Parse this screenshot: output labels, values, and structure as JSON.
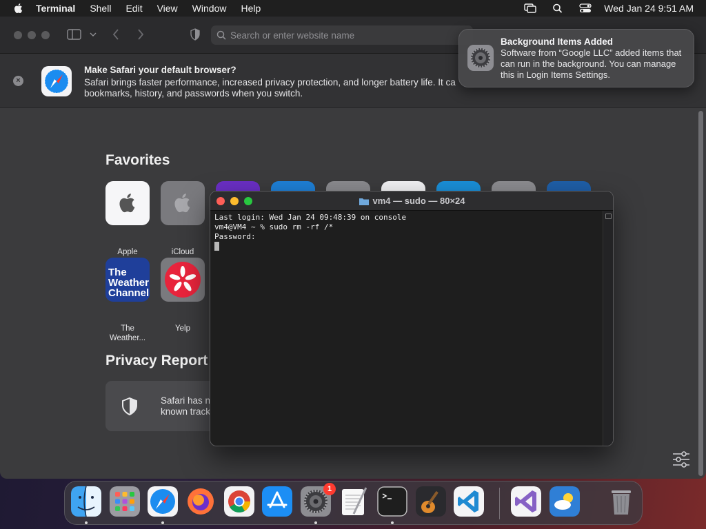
{
  "menubar": {
    "app_name": "Terminal",
    "items": [
      "Shell",
      "Edit",
      "View",
      "Window",
      "Help"
    ],
    "clock": "Wed Jan 24  9:51 AM"
  },
  "safari": {
    "url_placeholder": "Search or enter website name",
    "banner": {
      "title": "Make Safari your default browser?",
      "text_line1": "Safari brings faster performance, increased privacy protection, and longer battery life. It ca",
      "text_line2": "bookmarks, history, and passwords when you switch."
    },
    "favorites_title": "Favorites",
    "favorites": [
      {
        "label": "Apple"
      },
      {
        "label": "iCloud"
      },
      {
        "label_line1": "The",
        "label_line2": "Weather..."
      },
      {
        "label": "Yelp"
      }
    ],
    "weather_tile_text": [
      "The",
      "Weather",
      "Channel"
    ],
    "privacy_title": "Privacy Report",
    "privacy_text_line1": "Safari has n",
    "privacy_text_line2": "known track"
  },
  "notification": {
    "title": "Background Items Added",
    "body": "Software from “Google LLC” added items that can run in the background. You can manage this in Login Items Settings."
  },
  "terminal": {
    "title": "vm4 — sudo — 80×24",
    "lines": [
      "Last login: Wed Jan 24 09:48:39 on console",
      "vm4@VM4 ~ % sudo rm -rf /*",
      "Password:"
    ]
  },
  "dock": {
    "apps": [
      "finder-icon",
      "launchpad-icon",
      "safari-icon",
      "firefox-icon",
      "chrome-icon",
      "app-store-icon",
      "system-settings-icon",
      "textedit-icon",
      "terminal-icon",
      "garageband-icon",
      "vscode-icon",
      "visual-studio-icon",
      "weather-icon",
      "trash-icon"
    ],
    "settings_badge": "1"
  },
  "colors": {
    "accent_red": "#ff5f57",
    "accent_yellow": "#febc2e",
    "accent_green": "#28c840",
    "badge_red": "#ff3b30"
  }
}
